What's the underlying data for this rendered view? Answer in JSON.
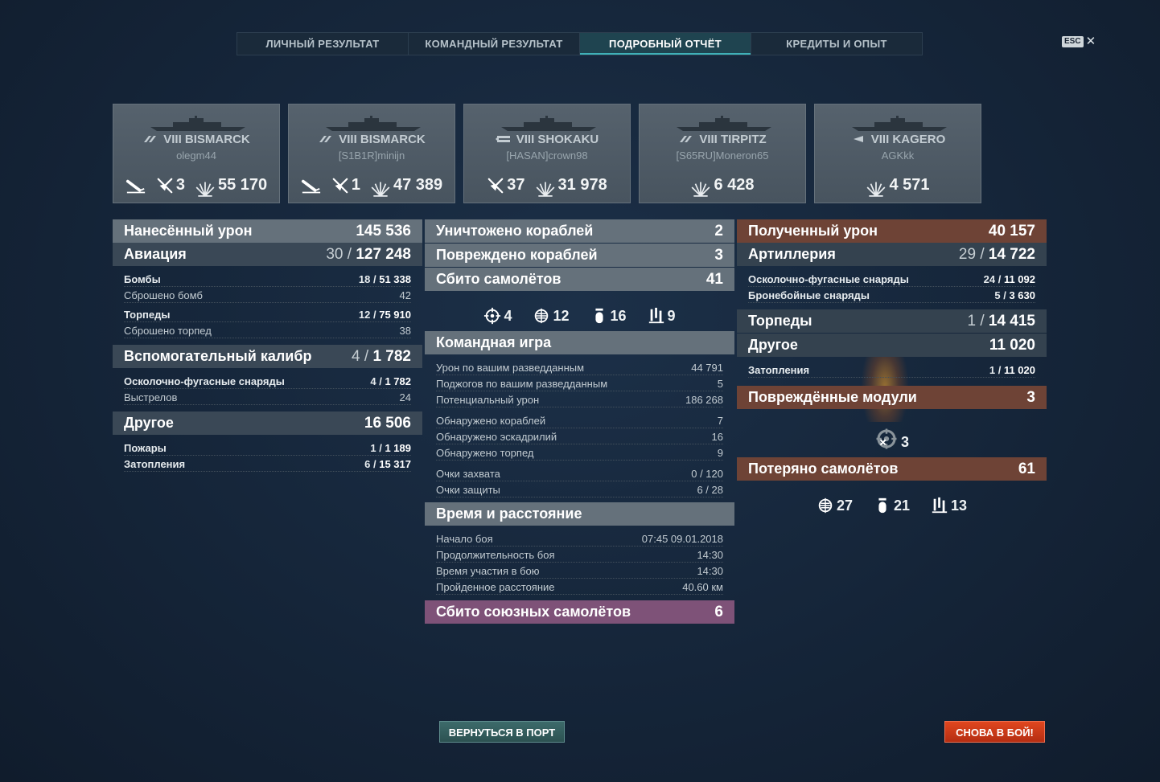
{
  "tabs": [
    {
      "label": "ЛИЧНЫЙ РЕЗУЛЬТАТ",
      "active": false
    },
    {
      "label": "КОМАНДНЫЙ РЕЗУЛЬТАТ",
      "active": false
    },
    {
      "label": "ПОДРОБНЫЙ ОТЧЁТ",
      "active": true
    },
    {
      "label": "КРЕДИТЫ И ОПЫТ",
      "active": false
    }
  ],
  "esc": {
    "key": "ESC",
    "close": "✕"
  },
  "ships": [
    {
      "tier": "VIII",
      "name": "BISMARCK",
      "player": "olegm44",
      "class_icon": "battleship-icon",
      "has_torpedo": true,
      "planes": "3",
      "damage": "55 170"
    },
    {
      "tier": "VIII",
      "name": "BISMARCK",
      "player": "[S1B1R]minijn",
      "class_icon": "battleship-icon",
      "has_torpedo": true,
      "planes": "1",
      "damage": "47 389"
    },
    {
      "tier": "VIII",
      "name": "SHOKAKU",
      "player": "[HASAN]crown98",
      "class_icon": "carrier-icon",
      "has_torpedo": false,
      "planes": "37",
      "damage": "31 978"
    },
    {
      "tier": "VIII",
      "name": "TIRPITZ",
      "player": "[S65RU]Moneron65",
      "class_icon": "battleship-icon",
      "has_torpedo": false,
      "planes": "",
      "damage": "6 428"
    },
    {
      "tier": "VIII",
      "name": "KAGERO",
      "player": "AGKkk",
      "class_icon": "destroyer-icon",
      "has_torpedo": false,
      "planes": "",
      "damage": "4 571"
    }
  ],
  "damage_dealt": {
    "title": "Нанесённый урон",
    "total": "145 536",
    "aviation": {
      "label": "Авиация",
      "hits": "30",
      "value": "127 248"
    },
    "bombs": {
      "label": "Бомбы",
      "hits": "18",
      "value": "51 338"
    },
    "bombs_dropped": {
      "label": "Сброшено бомб",
      "value": "42"
    },
    "torpedoes": {
      "label": "Торпеды",
      "hits": "12",
      "value": "75 910"
    },
    "torpedoes_dropped": {
      "label": "Сброшено торпед",
      "value": "38"
    },
    "secondary": {
      "label": "Вспомогательный калибр",
      "hits": "4",
      "value": "1 782"
    },
    "he_shells": {
      "label": "Осколочно-фугасные снаряды",
      "hits": "4",
      "value": "1 782"
    },
    "shots": {
      "label": "Выстрелов",
      "value": "24"
    },
    "other": {
      "label": "Другое",
      "value": "16 506"
    },
    "fires": {
      "label": "Пожары",
      "hits": "1",
      "value": "1 189"
    },
    "floods": {
      "label": "Затопления",
      "hits": "6",
      "value": "15 317"
    },
    "sep": "/"
  },
  "middle": {
    "destroyed": {
      "label": "Уничтожено кораблей",
      "value": "2"
    },
    "damaged": {
      "label": "Повреждено кораблей",
      "value": "3"
    },
    "planes_shot": {
      "label": "Сбито самолётов",
      "value": "41"
    },
    "planes_breakdown": [
      {
        "icon": "fighter-icon",
        "value": "4"
      },
      {
        "icon": "dive-bomber-icon",
        "value": "12"
      },
      {
        "icon": "bomb-icon",
        "value": "16"
      },
      {
        "icon": "torpedo-bomber-icon",
        "value": "9"
      }
    ],
    "team_play": {
      "title": "Командная игра",
      "rows1": [
        {
          "label": "Урон по вашим разведданным",
          "value": "44 791"
        },
        {
          "label": "Поджогов по вашим разведданным",
          "value": "5"
        },
        {
          "label": "Потенциальный урон",
          "value": "186 268"
        }
      ],
      "rows2": [
        {
          "label": "Обнаружено кораблей",
          "value": "7"
        },
        {
          "label": "Обнаружено эскадрилий",
          "value": "16"
        },
        {
          "label": "Обнаружено торпед",
          "value": "9"
        }
      ],
      "rows3": [
        {
          "label": "Очки захвата",
          "value": "0 / 120"
        },
        {
          "label": "Очки защиты",
          "value": "6 / 28"
        }
      ]
    },
    "time": {
      "title": "Время и расстояние",
      "rows": [
        {
          "label": "Начало боя",
          "value": "07:45  09.01.2018"
        },
        {
          "label": "Продолжительность боя",
          "value": "14:30"
        },
        {
          "label": "Время участия в бою",
          "value": "14:30"
        },
        {
          "label": "Пройденное расстояние",
          "value": "40.60 км"
        }
      ]
    },
    "allied_planes": {
      "label": "Сбито союзных самолётов",
      "value": "6"
    }
  },
  "damage_received": {
    "title": "Полученный урон",
    "total": "40 157",
    "artillery": {
      "label": "Артиллерия",
      "hits": "29",
      "value": "14 722"
    },
    "he_shells": {
      "label": "Осколочно-фугасные снаряды",
      "hits": "24",
      "value": "11 092"
    },
    "ap_shells": {
      "label": "Бронебойные снаряды",
      "hits": "5",
      "value": "3 630"
    },
    "torpedoes": {
      "label": "Торпеды",
      "hits": "1",
      "value": "14 415"
    },
    "other": {
      "label": "Другое",
      "value": "11 020"
    },
    "floods": {
      "label": "Затопления",
      "hits": "1",
      "value": "11 020"
    },
    "modules": {
      "label": "Повреждённые модули",
      "value": "3"
    },
    "modules_icon_value": "3",
    "planes_lost": {
      "label": "Потеряно самолётов",
      "value": "61"
    },
    "planes_lost_breakdown": [
      {
        "icon": "dive-bomber-icon",
        "value": "27"
      },
      {
        "icon": "bomb-icon",
        "value": "21"
      },
      {
        "icon": "torpedo-bomber-icon",
        "value": "13"
      }
    ],
    "sep": "/"
  },
  "buttons": {
    "port": "ВЕРНУТЬСЯ В ПОРТ",
    "battle": "СНОВА В БОЙ!"
  },
  "colors": {
    "accent_teal": "#3fb0b8",
    "received_header": "#6e4336",
    "allied_header": "#7e5278",
    "battle_button": "#d63d1a"
  }
}
